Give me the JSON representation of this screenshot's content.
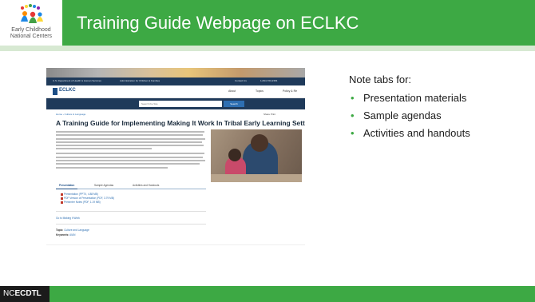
{
  "slide": {
    "title": "Training Guide Webpage on ECLKC",
    "logo": {
      "line1": "Early Childhood",
      "line2": "National Centers"
    },
    "footer_brand_prefix": "NC",
    "footer_brand_bold": "ECDTL",
    "colors": {
      "accent": "#3da944",
      "footer_brand_bg": "#1b1b1b"
    }
  },
  "webpage": {
    "gov_left": "U.S. Department of Health & Human Services",
    "gov_mid": "Administration for Children & Families",
    "gov_right_1": "Contact Us",
    "gov_right_2": "1-844-763-2354",
    "site_name": "ECLKC",
    "nav": [
      "About",
      "Topics",
      "Policy & Re"
    ],
    "search_placeholder": "Search the Site",
    "search_button": "Search",
    "breadcrumb": "Home › Culture & Language",
    "share": "Share  Print",
    "heading": "A Training Guide for Implementing Making It Work In Tribal Early Learning Settings",
    "tabs": [
      "Presentation",
      "Sample Agendas",
      "Activities and Handouts"
    ],
    "files": [
      "Presentation (PPTX, 4.88 MB)",
      "PDF Version of Presentation (PDF, 3.79 MB)",
      "Presenter Notes (PDF, 1.19 MB)"
    ],
    "back_link": "Go to Making It Work",
    "topic_label": "Topic:",
    "topic_value": "Culture and Language",
    "keywords_label": "Keywords:",
    "keywords_value": "AIAN"
  },
  "note": {
    "heading": "Note tabs for:",
    "bullets": [
      "Presentation materials",
      "Sample agendas",
      "Activities and handouts"
    ]
  }
}
